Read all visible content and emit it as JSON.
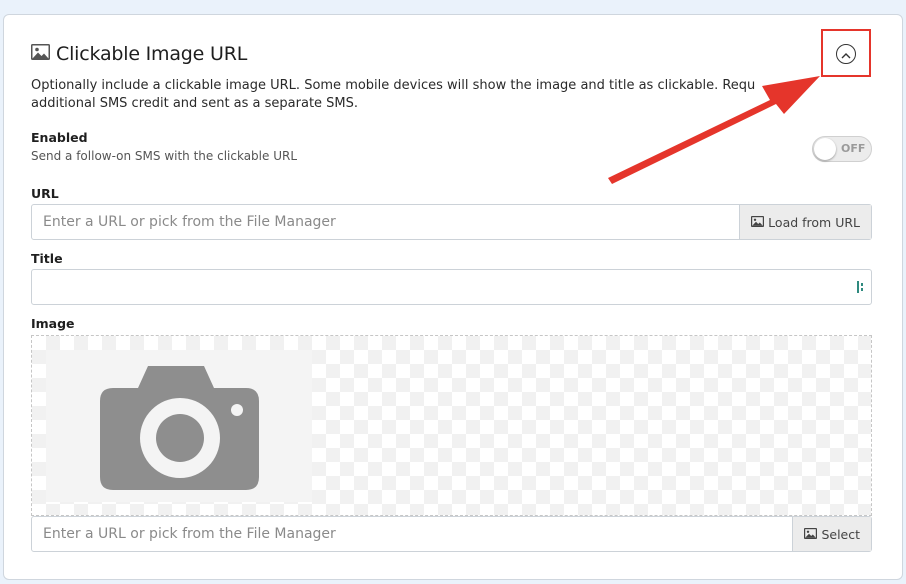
{
  "section": {
    "title": "Clickable Image URL",
    "description_line1": "Optionally include a clickable image URL. Some mobile devices will show the image and title as clickable. Requ",
    "description_line2": "additional SMS credit and sent as a separate SMS."
  },
  "enabled": {
    "label": "Enabled",
    "help": "Send a follow-on SMS with the clickable URL",
    "toggle_text": "OFF",
    "value": false
  },
  "url": {
    "label": "URL",
    "placeholder": "Enter a URL or pick from the File Manager",
    "value": "",
    "button_label": "Load from URL"
  },
  "title_field": {
    "label": "Title",
    "value": ""
  },
  "image": {
    "label": "Image",
    "placeholder": "Enter a URL or pick from the File Manager",
    "value": "",
    "button_label": "Select"
  },
  "colors": {
    "annotation_red": "#e5352b",
    "icon_gray": "#8e8e8e",
    "grip_teal": "#2f8a7f"
  },
  "icons": {
    "title_icon": "image-icon",
    "collapse": "chevron-up-circle-icon",
    "placeholder": "camera-icon"
  }
}
